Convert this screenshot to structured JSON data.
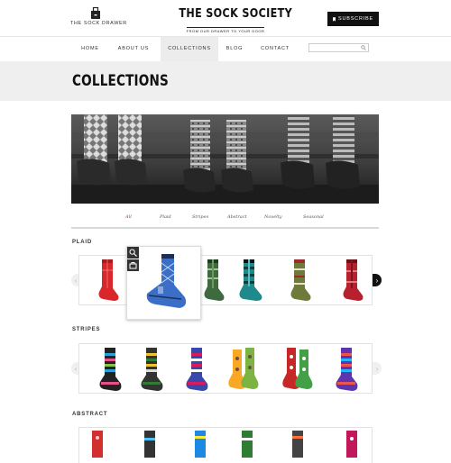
{
  "header": {
    "drawer_label": "THE SOCK DRAWER",
    "drawer_icon": "sock-drawer-icon",
    "logo_title": "THE SOCK SOCIETY",
    "logo_tagline": "FROM OUR DRAWER TO YOUR DOOR",
    "subscribe_label": "SUBSCRIBE",
    "subscribe_icon": "bookmark-icon"
  },
  "nav": {
    "items": [
      {
        "label": "HOME"
      },
      {
        "label": "ABOUT US"
      },
      {
        "label": "COLLECTIONS"
      },
      {
        "label": "BLOG"
      },
      {
        "label": "CONTACT"
      }
    ],
    "active": "COLLECTIONS",
    "search_placeholder": "",
    "search_icon": "search-icon"
  },
  "page": {
    "title": "COLLECTIONS"
  },
  "filters": {
    "items": [
      "All",
      "Plaid",
      "Stripes",
      "Abstract",
      "Novelty",
      "Seasonal"
    ],
    "active": "All"
  },
  "sections": [
    {
      "title": "PLAID"
    },
    {
      "title": "STRIPES"
    },
    {
      "title": "ABSTRACT"
    }
  ],
  "popup": {
    "zoom_icon": "zoom-icon",
    "cart_icon": "add-to-cart-icon"
  },
  "colors": {
    "accent": "#c02a48",
    "dark": "#111111",
    "banner_bg": "#efefef",
    "nav_active_bg": "#ececec"
  }
}
